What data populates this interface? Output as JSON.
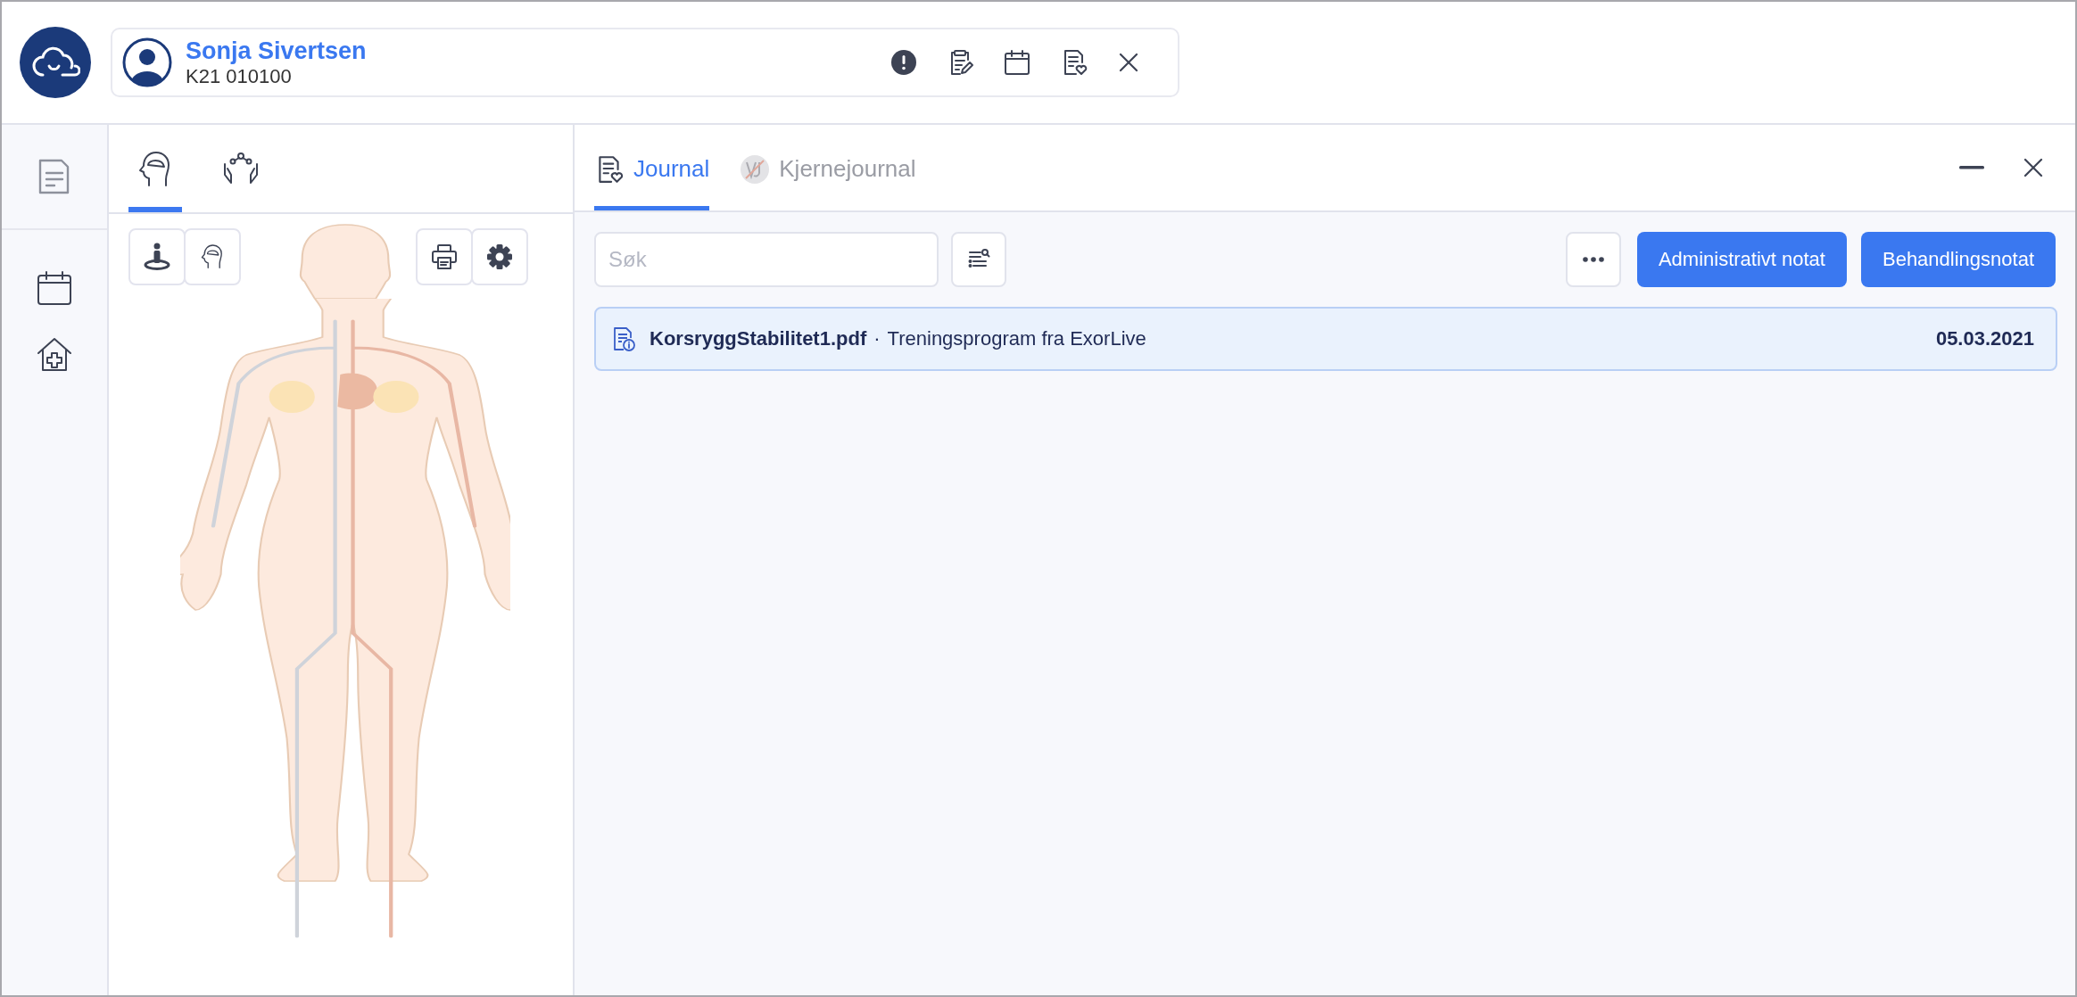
{
  "patient": {
    "name": "Sonja Sivertsen",
    "id": "K21 010100"
  },
  "left_tabs": [
    {
      "kind": "head",
      "selected": true
    },
    {
      "kind": "care",
      "selected": false
    }
  ],
  "journal_tabs": [
    {
      "label": "Journal",
      "kind": "journal",
      "selected": true
    },
    {
      "label": "Kjernejournal",
      "kind": "core",
      "selected": false
    }
  ],
  "search": {
    "placeholder": "Søk"
  },
  "buttons": [
    "Administrativt notat",
    "Behandlingsnotat"
  ],
  "documents": [
    {
      "file": "KorsryggStabilitet1.pdf",
      "separator": "·",
      "description": "Treningsprogram fra ExorLive",
      "date": "05.03.2021",
      "selected": true
    }
  ]
}
